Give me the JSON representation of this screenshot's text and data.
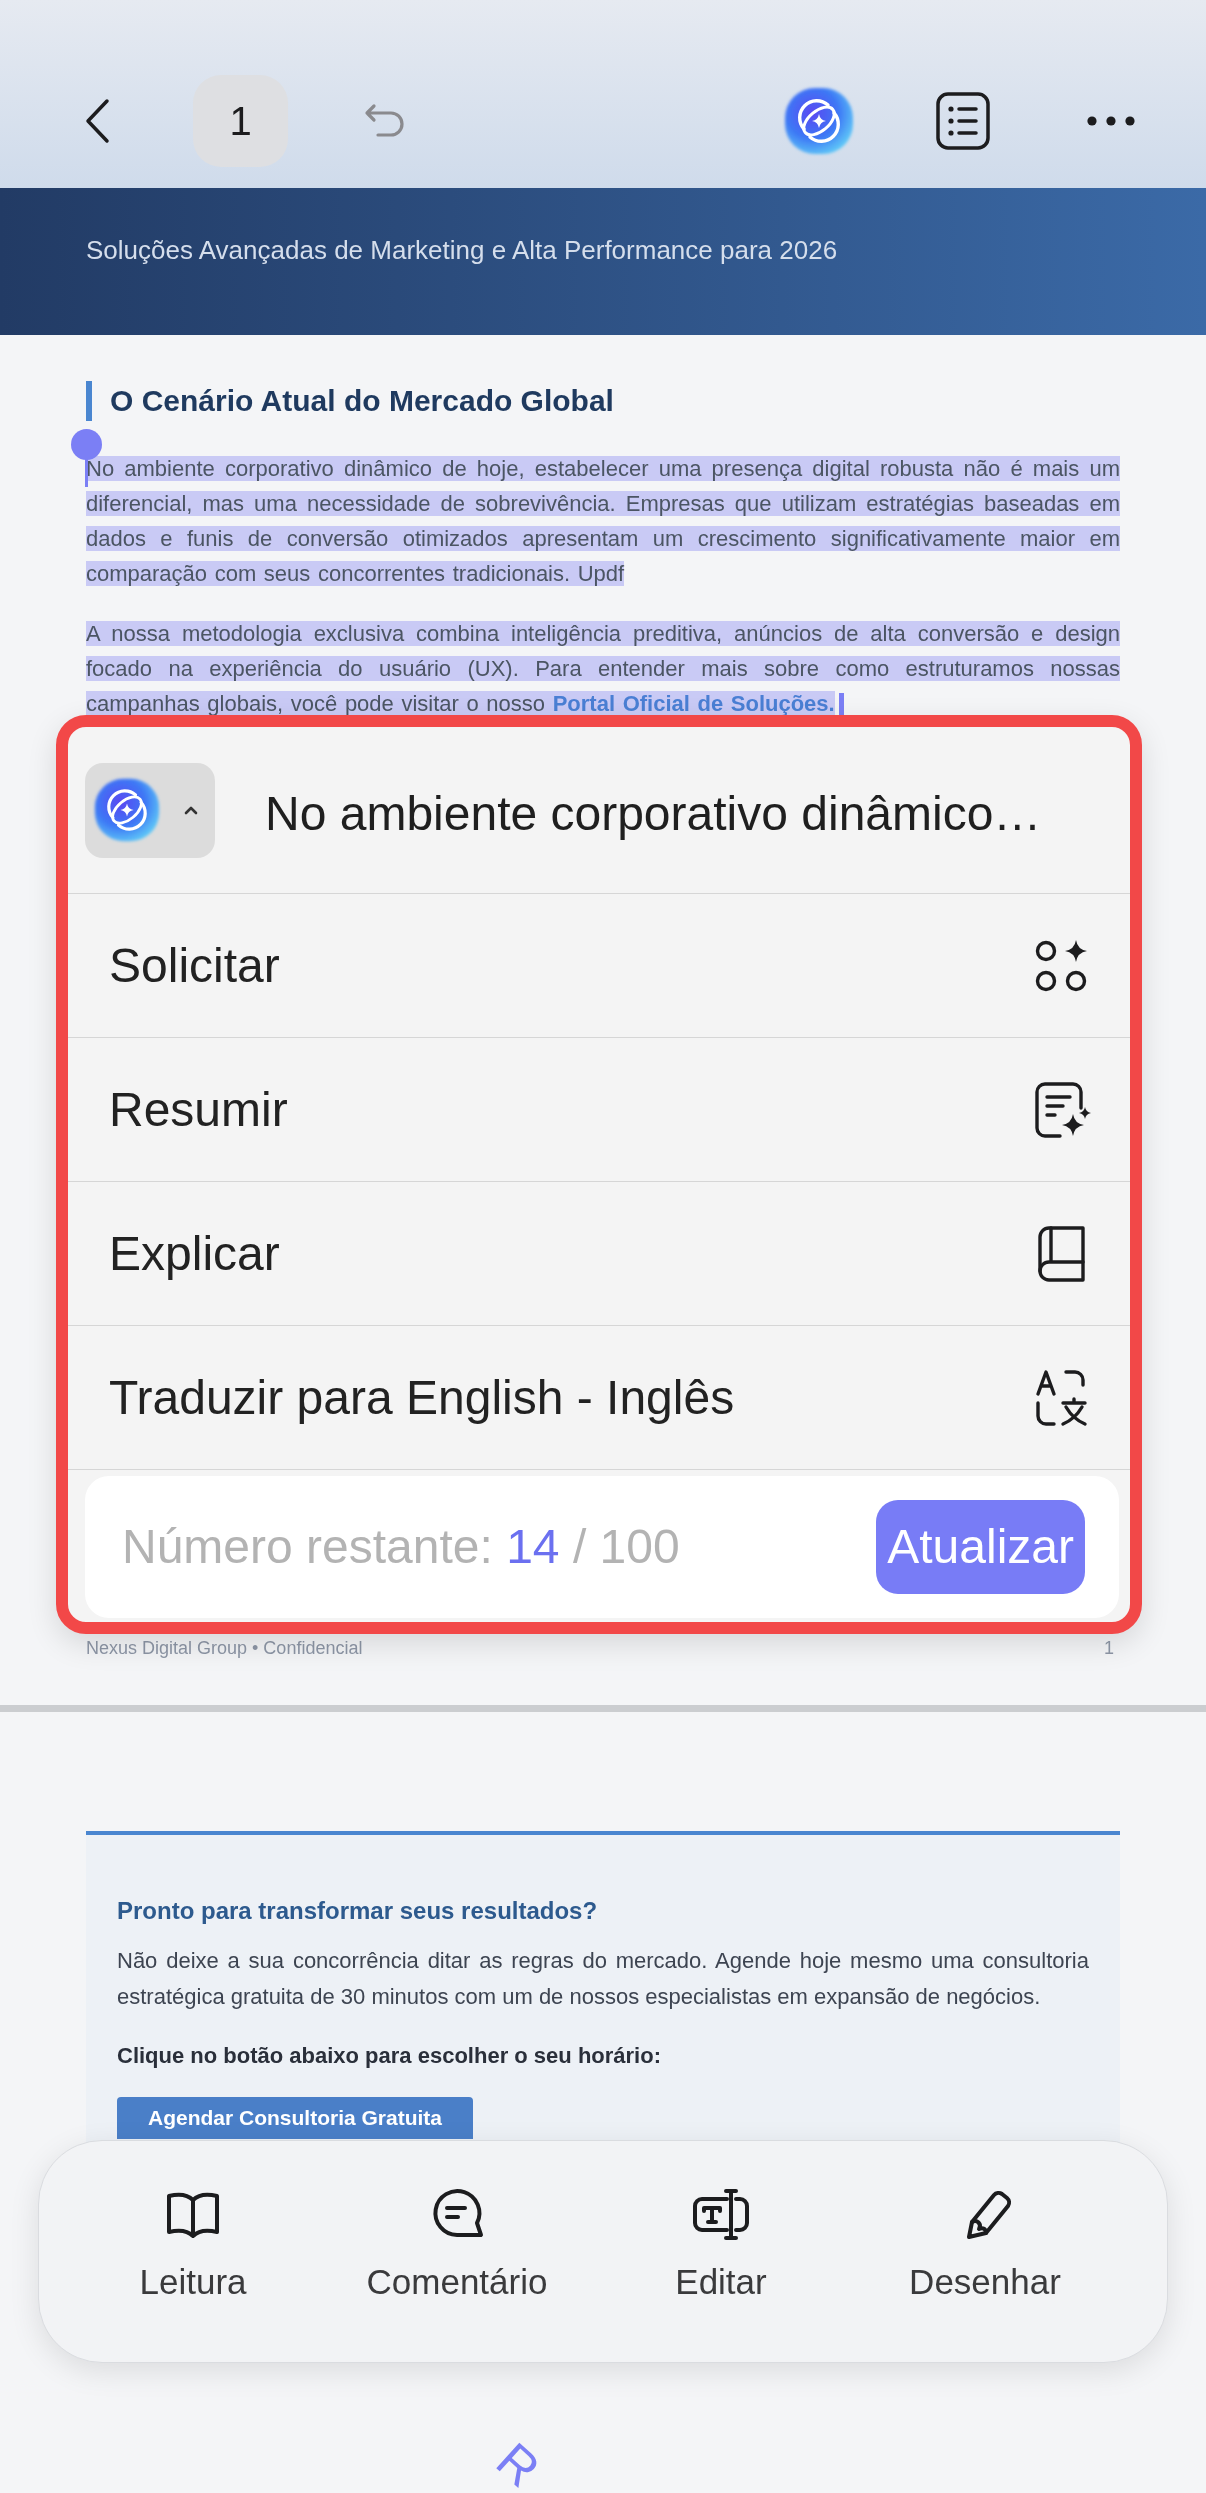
{
  "top_bar": {
    "page_number": "1"
  },
  "page_1": {
    "subtitle": "Soluções Avançadas de Marketing e Alta Performance para 2026",
    "section_title": "O Cenário Atual do Mercado Global",
    "paragraphs": [
      {
        "text": "No ambiente corporativo dinâmico de hoje, estabelecer uma presença digital robusta não é mais um diferencial, mas uma necessidade de sobrevivência. Empresas que utilizam estratégias baseadas em dados e funis de conversão otimizados apresentam um crescimento significativamente maior em comparação com seus concorrentes tradicionais. Updf",
        "selected": true
      },
      {
        "text": "A nossa metodologia exclusiva combina inteligência preditiva, anúncios de alta conversão e design focado na experiência do usuário (UX). Para entender mais sobre como estruturamos nossas campanhas globais, você pode visitar o nosso",
        "link": "Portal Oficial de Soluções.",
        "selected": true
      }
    ],
    "footer": "Nexus Digital Group • Confidencial",
    "page_number": "1"
  },
  "page_2": {
    "title": "Pronto para transformar seus resultados?",
    "text": "Não deixe a sua concorrência ditar as regras do mercado. Agende hoje mesmo uma consultoria estratégica gratuita de 30 minutos com um de nossos especialistas em expansão de negócios.",
    "instruction": "Clique no botão abaixo para escolher o seu horário:",
    "button": "Agendar Consultoria Gratuita",
    "rotated_text": "R"
  },
  "ai_popup": {
    "highlighted": true,
    "preview": "No ambiente corporativo dinâmico…",
    "actions": [
      {
        "label": "Solicitar"
      },
      {
        "label": "Resumir"
      },
      {
        "label": "Explicar"
      },
      {
        "label": "Traduzir para English - Inglês"
      }
    ],
    "quota": {
      "label": "Número restante:",
      "remaining": "14",
      "total": "/ 100"
    },
    "upgrade_button": "Atualizar"
  },
  "bottom_toolbar": {
    "tools": [
      {
        "label": "Leitura"
      },
      {
        "label": "Comentário"
      },
      {
        "label": "Editar"
      },
      {
        "label": "Desenhar"
      }
    ]
  }
}
